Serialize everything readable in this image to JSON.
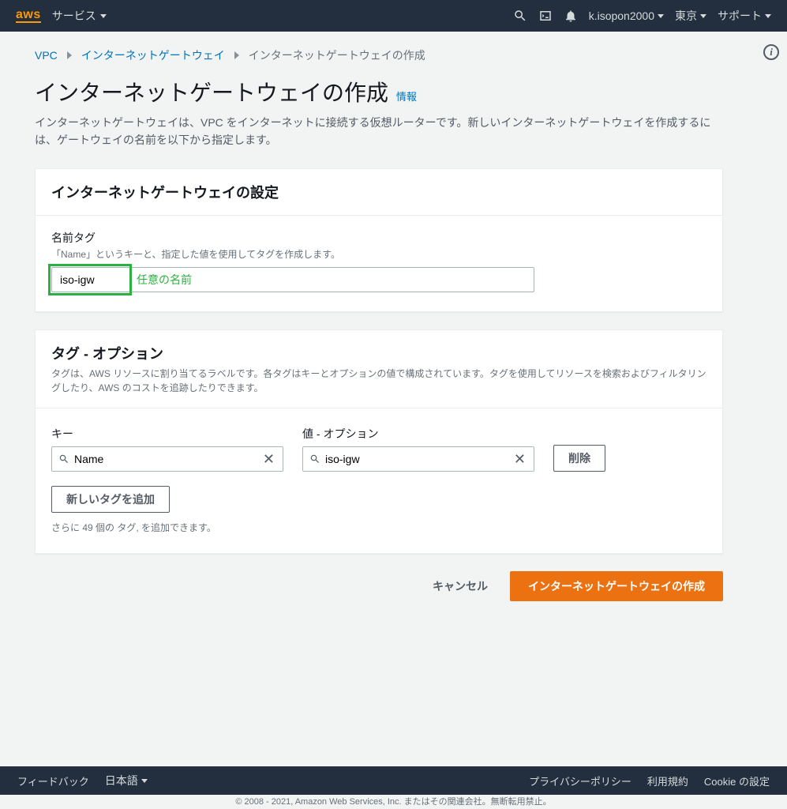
{
  "nav": {
    "logo": "aws",
    "services": "サービス",
    "user": "k.isopon2000",
    "region": "東京",
    "support": "サポート"
  },
  "breadcrumb": {
    "vpc": "VPC",
    "igw": "インターネットゲートウェイ",
    "current": "インターネットゲートウェイの作成"
  },
  "page": {
    "title": "インターネットゲートウェイの作成",
    "info_label": "情報",
    "description": "インターネットゲートウェイは、VPC をインターネットに接続する仮想ルーターです。新しいインターネットゲートウェイを作成するには、ゲートウェイの名前を以下から指定します。"
  },
  "settings_panel": {
    "title": "インターネットゲートウェイの設定",
    "name_label": "名前タグ",
    "name_help": "「Name」というキーと、指定した値を使用してタグを作成します。",
    "name_value": "iso-igw",
    "annotation": "任意の名前"
  },
  "tags_panel": {
    "title": "タグ - オプション",
    "description": "タグは、AWS リソースに割り当てるラベルです。各タグはキーとオプションの値で構成されています。タグを使用してリソースを検索およびフィルタリングしたり、AWS のコストを追跡したりできます。",
    "key_label": "キー",
    "value_label": "値 - オプション",
    "key_value": "Name",
    "val_value": "iso-igw",
    "delete_label": "削除",
    "add_label": "新しいタグを追加",
    "limit_text": "さらに 49 個の タグ, を追加できます。"
  },
  "actions": {
    "cancel": "キャンセル",
    "create": "インターネットゲートウェイの作成"
  },
  "footer": {
    "feedback": "フィードバック",
    "language": "日本語",
    "privacy": "プライバシーポリシー",
    "terms": "利用規約",
    "cookie": "Cookie の設定",
    "copyright": "© 2008 - 2021, Amazon Web Services, Inc. またはその関連会社。無断転用禁止。"
  }
}
